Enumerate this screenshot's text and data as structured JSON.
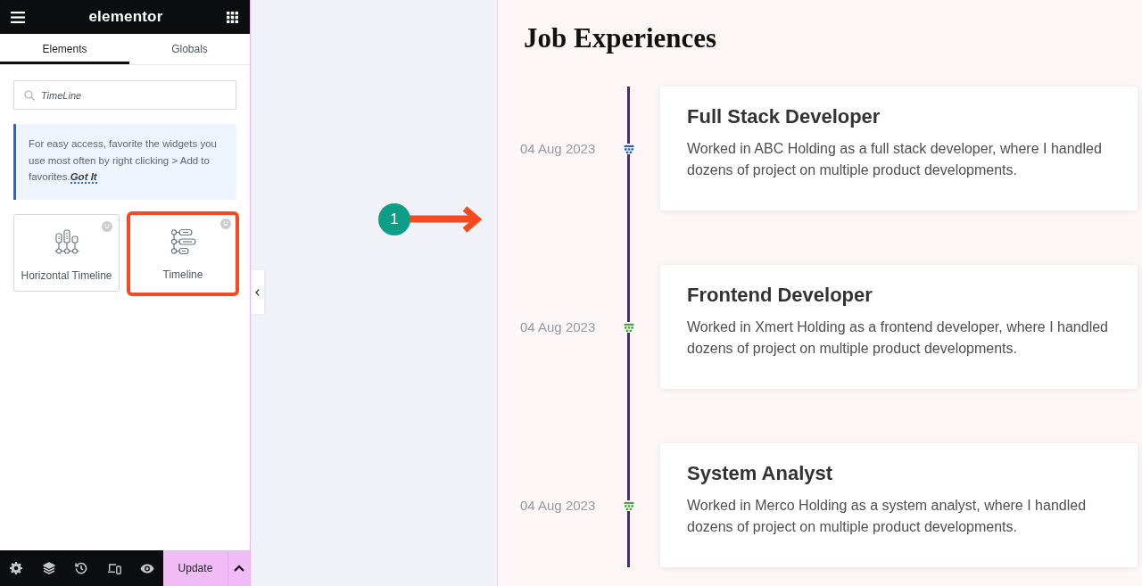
{
  "panel": {
    "brand": "elementor",
    "tabs": [
      {
        "label": "Elements",
        "selected": true
      },
      {
        "label": "Globals",
        "selected": false
      }
    ],
    "search": {
      "value": "TimeLine"
    },
    "notice": {
      "text": "For easy access, favorite the widgets you use most often by right clicking > Add to favorites.",
      "link": "Got It"
    },
    "widgets": [
      {
        "kind": "horizontal",
        "label": "Horizontal Timeline",
        "highlighted": false
      },
      {
        "kind": "vertical",
        "label": "Timeline",
        "highlighted": true
      }
    ],
    "update_button": "Update"
  },
  "annotation": {
    "step": "1"
  },
  "page": {
    "heading": "Job Experiences",
    "items": [
      {
        "date": "04 Aug 2023",
        "title": "Full Stack Developer",
        "description": "Worked in ABC Holding as a full stack developer, where I handled dozens of project on multiple product developments.",
        "color": "#2f5fb3"
      },
      {
        "date": "04 Aug 2023",
        "title": "Frontend Developer",
        "description": "Worked in Xmert Holding as a frontend developer, where I handled dozens of project on multiple product developments.",
        "color": "#4f9f45"
      },
      {
        "date": "04 Aug 2023",
        "title": "System Analyst",
        "description": "Worked in Merco Holding as a system analyst, where I handled dozens of project on multiple product developments.",
        "color": "#4f9f45"
      }
    ]
  }
}
